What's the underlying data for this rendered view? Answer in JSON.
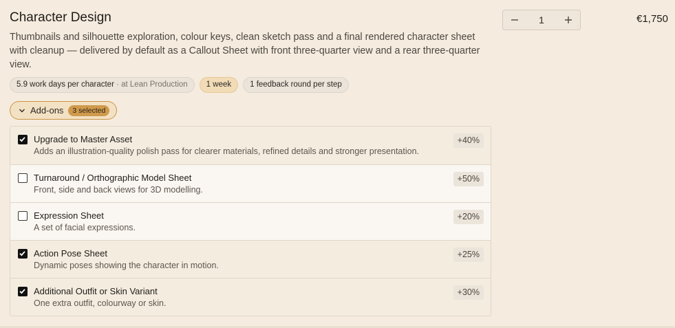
{
  "item": {
    "title": "Character Design",
    "description": "Thumbnails and silhouette exploration, colour keys, clean sketch pass and a final rendered character sheet with cleanup — delivered by default as a Callout Sheet with front three-quarter view and a rear three-quarter view.",
    "price": "€1,750",
    "quantity": "1"
  },
  "tags": {
    "work_days": "5.9 work days per character",
    "work_days_suffix": " · at Lean Production",
    "duration": "1 week",
    "feedback": "1 feedback round per step"
  },
  "addons": {
    "toggle_label": "Add-ons",
    "selected_count": "3 selected",
    "items": [
      {
        "name": "Upgrade to Master Asset",
        "description": "Adds an illustration-quality polish pass for clearer materials, refined details and stronger presentation.",
        "percent": "+40%",
        "checked": true
      },
      {
        "name": "Turnaround / Orthographic Model Sheet",
        "description": "Front, side and back views for 3D modelling.",
        "percent": "+50%",
        "checked": false
      },
      {
        "name": "Expression Sheet",
        "description": "A set of facial expressions.",
        "percent": "+20%",
        "checked": false
      },
      {
        "name": "Action Pose Sheet",
        "description": "Dynamic poses showing the character in motion.",
        "percent": "+25%",
        "checked": true
      },
      {
        "name": "Additional Outfit or Skin Variant",
        "description": "One extra outfit, colourway or skin.",
        "percent": "+30%",
        "checked": true
      }
    ]
  },
  "colors": {
    "background": "#f5ecdf",
    "accent": "#cf9a4c",
    "accent_border": "#c9954a"
  },
  "icons": {
    "minus": "minus-icon",
    "plus": "plus-icon",
    "chevron": "chevron-down-icon",
    "check": "check-icon"
  }
}
